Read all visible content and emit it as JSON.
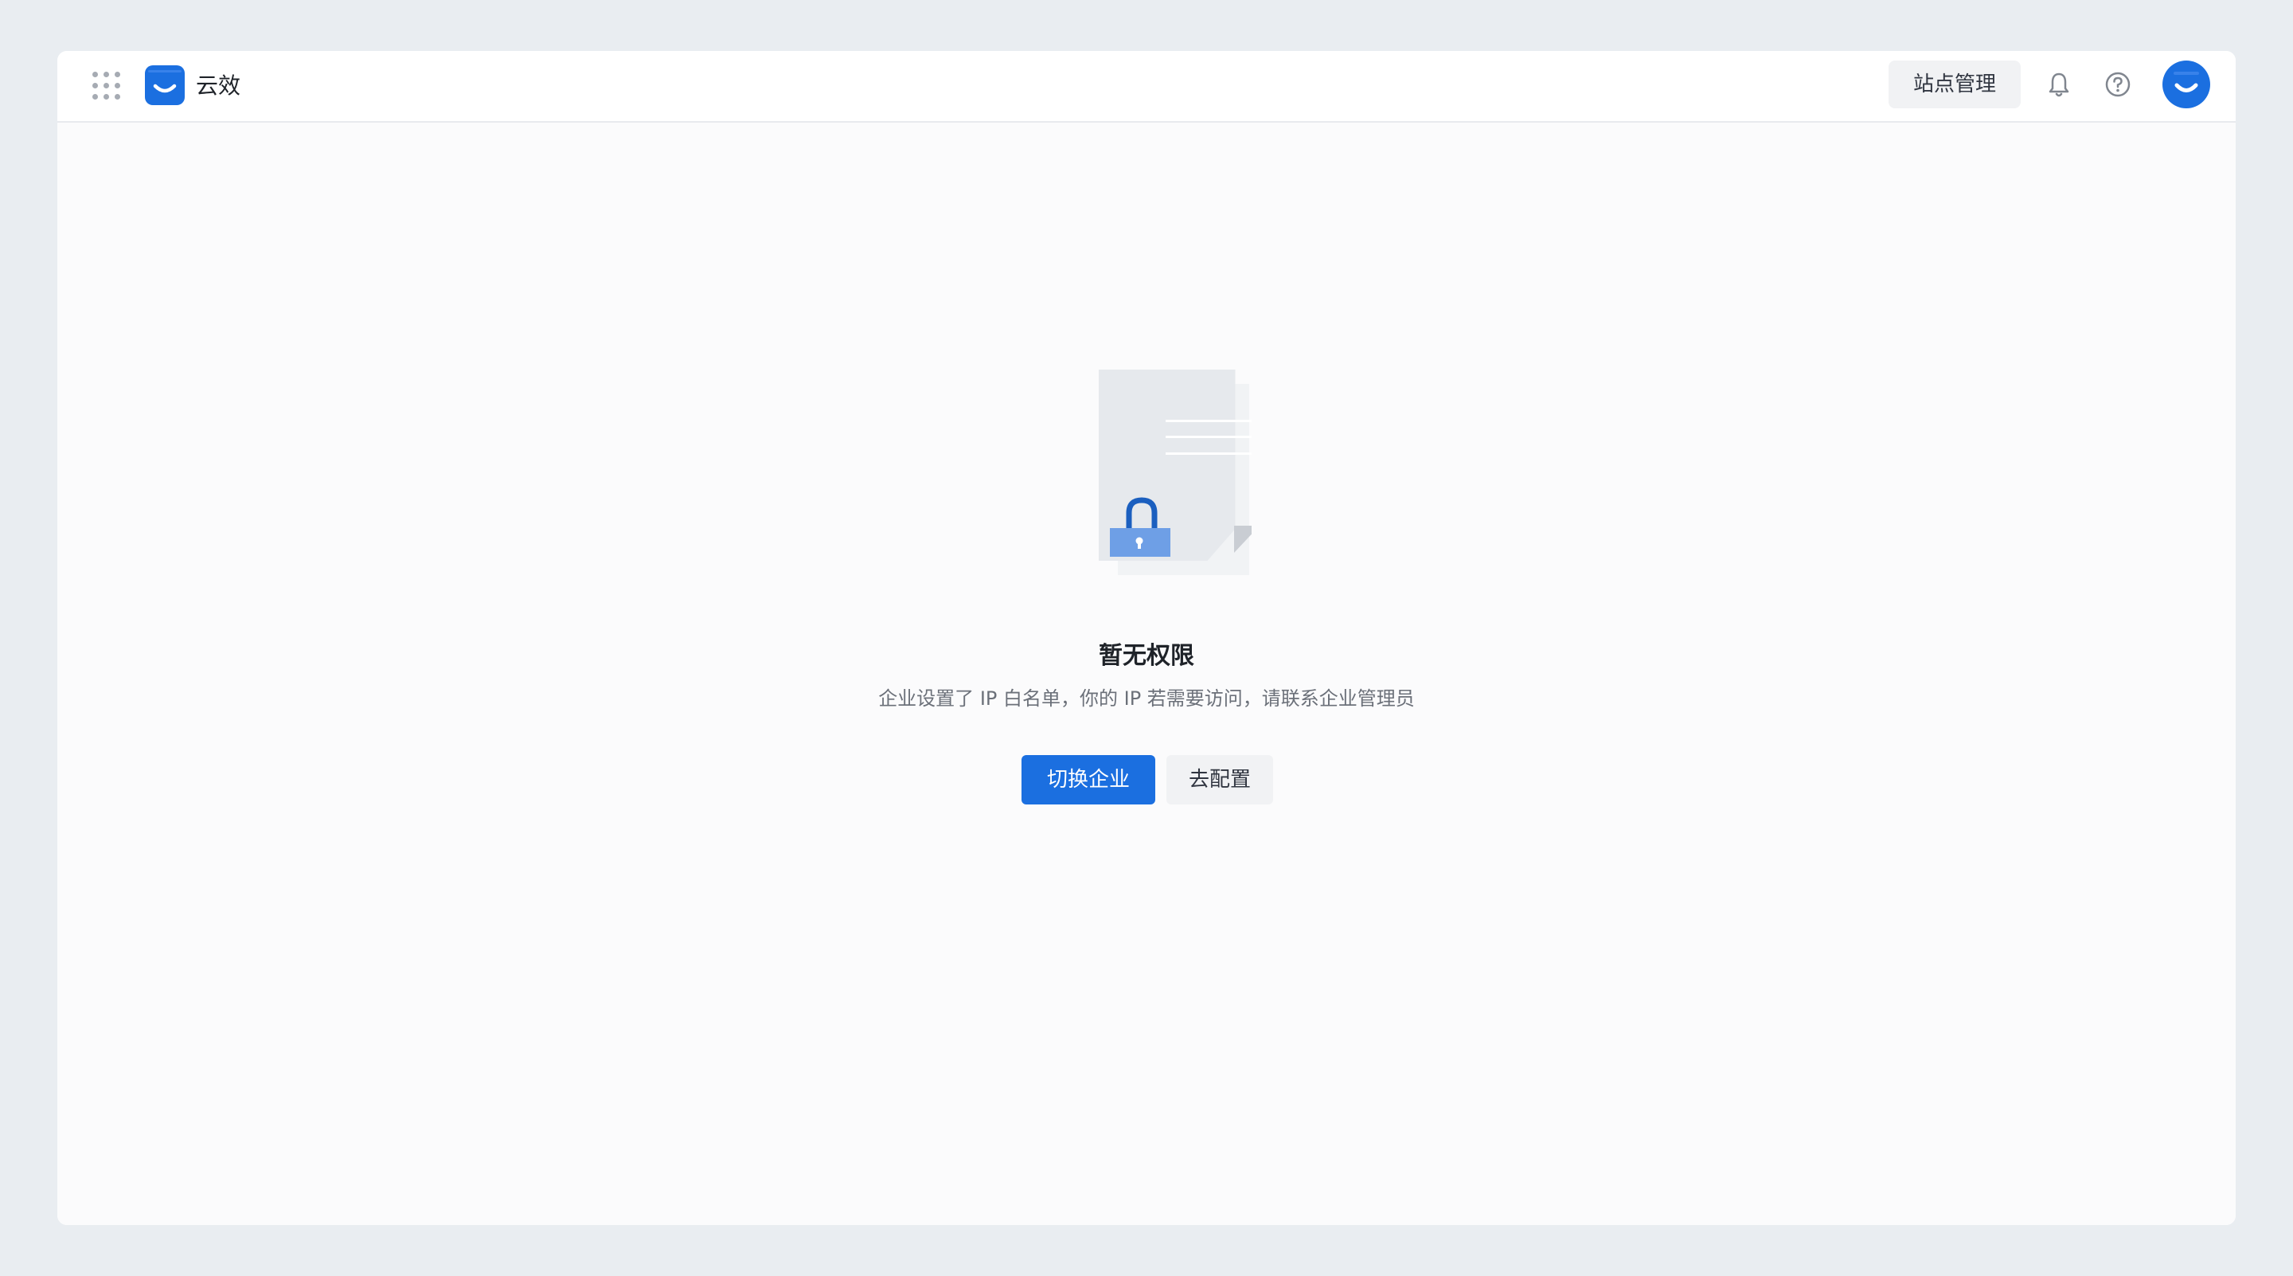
{
  "header": {
    "app_name": "云效",
    "site_admin_label": "站点管理",
    "icons": {
      "apps": "apps-grid-icon",
      "logo": "yunxiao-logo-icon",
      "notifications": "bell-icon",
      "help": "help-circle-icon",
      "avatar": "user-avatar"
    }
  },
  "empty_state": {
    "illustration": "locked-document-icon",
    "title": "暂无权限",
    "description": "企业设置了 IP 白名单，你的 IP 若需要访问，请联系企业管理员",
    "primary_button": "切换企业",
    "secondary_button": "去配置"
  },
  "colors": {
    "accent": "#1b6fe0",
    "page_background": "#e9edf1",
    "window_background": "#ffffff",
    "text_primary": "#1f2329",
    "text_secondary": "#6b7079",
    "button_secondary_bg": "#f1f2f4"
  }
}
